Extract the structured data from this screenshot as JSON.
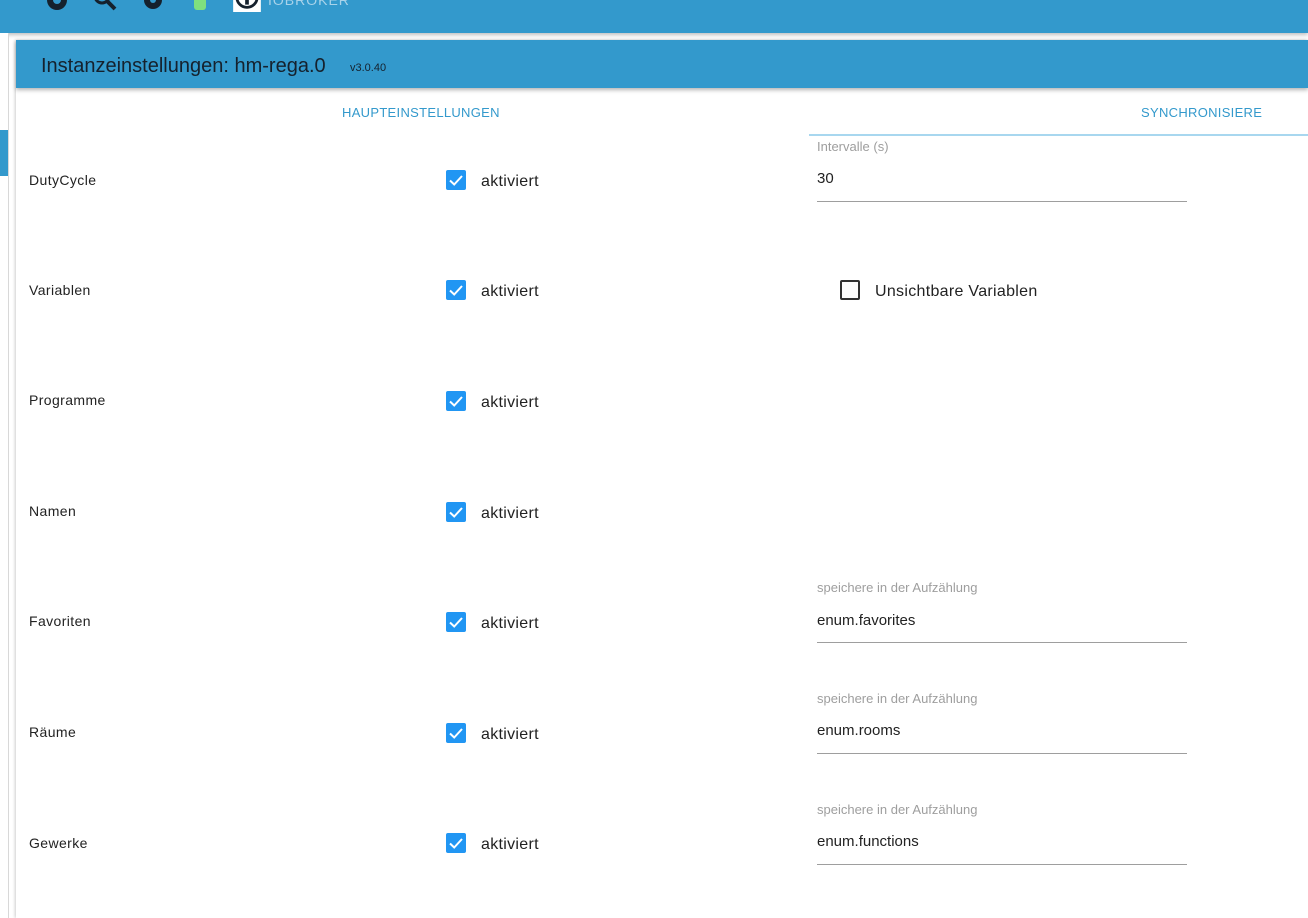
{
  "topbar": {
    "logo_text": "IOBROKER"
  },
  "dialog": {
    "title": "Instanzeinstellungen: hm-rega.0",
    "version": "v3.0.40"
  },
  "tabs": {
    "main": "HAUPTEINSTELLUNGEN",
    "sync": "SYNCHRONISIERE"
  },
  "rows": [
    {
      "label": "DutyCycle",
      "checkbox_label": "aktiviert",
      "checked": true
    },
    {
      "label": "Variablen",
      "checkbox_label": "aktiviert",
      "checked": true
    },
    {
      "label": "Programme",
      "checkbox_label": "aktiviert",
      "checked": true
    },
    {
      "label": "Namen",
      "checkbox_label": "aktiviert",
      "checked": true
    },
    {
      "label": "Favoriten",
      "checkbox_label": "aktiviert",
      "checked": true
    },
    {
      "label": "Räume",
      "checkbox_label": "aktiviert",
      "checked": true
    },
    {
      "label": "Gewerke",
      "checkbox_label": "aktiviert",
      "checked": true
    }
  ],
  "fields": {
    "interval": {
      "label": "Intervalle (s)",
      "value": "30"
    },
    "invisible_vars": {
      "label": "Unsichtbare Variablen",
      "checked": false
    },
    "favorites": {
      "label": "speichere in der Aufzählung",
      "value": "enum.favorites"
    },
    "rooms": {
      "label": "speichere in der Aufzählung",
      "value": "enum.rooms"
    },
    "functions": {
      "label": "speichere in der Aufzählung",
      "value": "enum.functions"
    }
  },
  "colors": {
    "primary": "#3399cc",
    "checkbox": "#2196f3"
  }
}
